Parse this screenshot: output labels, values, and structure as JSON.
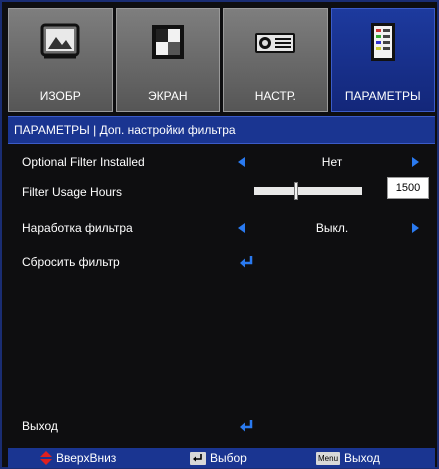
{
  "tabs": [
    {
      "label": "ИЗОБР",
      "icon": "image-icon",
      "active": false
    },
    {
      "label": "ЭКРАН",
      "icon": "screen-icon",
      "active": false
    },
    {
      "label": "НАСТР.",
      "icon": "projector-icon",
      "active": false
    },
    {
      "label": "ПАРАМЕТРЫ",
      "icon": "options-icon",
      "active": true
    }
  ],
  "title": "ПАРАМЕТРЫ | Доп. настройки фильтра",
  "rows": {
    "filter_installed": {
      "label": "Optional Filter Installed",
      "value": "Нет"
    },
    "usage_hours": {
      "label": "Filter Usage Hours",
      "value": "1500",
      "level": 0.38
    },
    "reminder": {
      "label": "Наработка фильтра",
      "value": "Выкл."
    },
    "reset": {
      "label": "Сбросить фильтр"
    },
    "exit": {
      "label": "Выход"
    }
  },
  "footer": {
    "updown": "ВверхВниз",
    "select": "Выбор",
    "menu_key": "Menu",
    "exit": "Выход"
  },
  "colors": {
    "accent": "#1a3591",
    "arrow": "#2a7af0",
    "tab_active": "#1d3a9e"
  }
}
